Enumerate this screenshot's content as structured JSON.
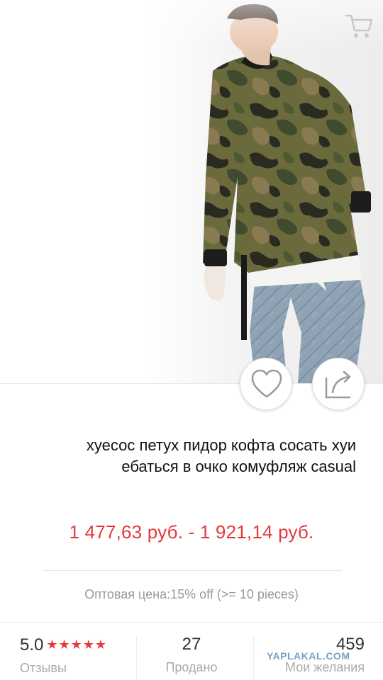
{
  "product": {
    "title_line1": "хуесос петух пидор кофта сосать хуи",
    "title_line2": "ебаться в очко комуфляж casual",
    "price": "1 477,63 руб. - 1 921,14 руб.",
    "wholesale": "Оптовая цена:15% off (>= 10 pieces)"
  },
  "stats": {
    "rating_value": "5.0",
    "stars": "★★★★★",
    "rating_label": "Отзывы",
    "sold_value": "27",
    "sold_label": "Продано",
    "wishlist_value": "459",
    "wishlist_label": "Мои желания"
  },
  "watermark": "YAPLAKAL.COM",
  "icons": {
    "back": "chevron-left-icon",
    "cart": "cart-icon",
    "like": "heart-icon",
    "share": "share-icon"
  },
  "colors": {
    "price": "#e4393c",
    "stars": "#e4393c",
    "muted": "#999999"
  }
}
